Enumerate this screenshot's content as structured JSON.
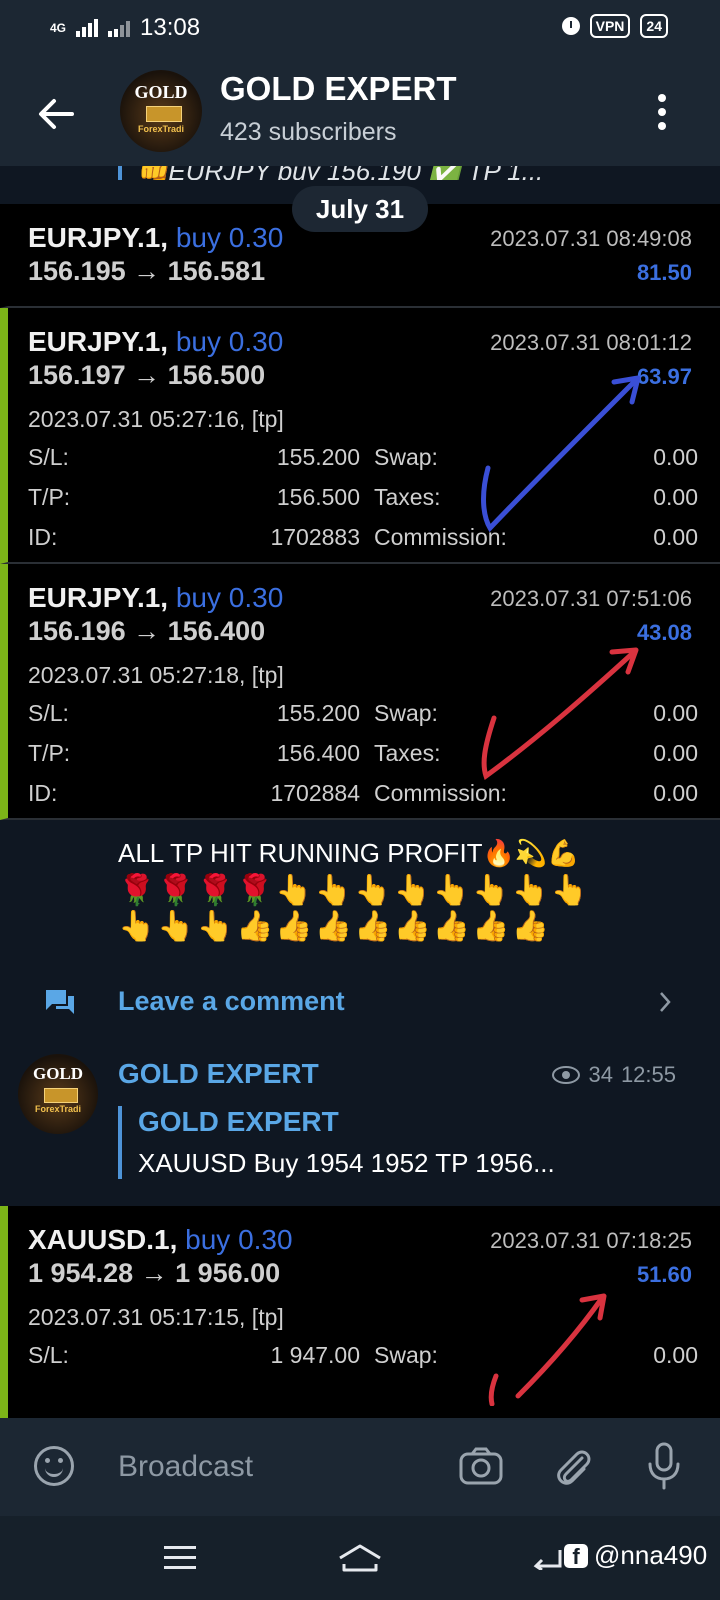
{
  "status_bar": {
    "network": "4G",
    "time": "13:08",
    "vpn": "VPN",
    "battery": "24"
  },
  "header": {
    "title": "GOLD EXPERT",
    "subtitle": "423 subscribers",
    "avatar_text": "GOLD",
    "avatar_sub": "ForexTradi"
  },
  "chat": {
    "reply_preview": "👊EURJPY buy 156.190 ✅ TP 1...",
    "date_pill": "July 31",
    "trades": [
      {
        "symbol": "EURJPY.1,",
        "dir": "buy 0.30",
        "prices": "156.195 → 156.581",
        "time": "2023.07.31 08:49:08",
        "profit": "81.50"
      },
      {
        "symbol": "EURJPY.1,",
        "dir": "buy 0.30",
        "prices": "156.197 → 156.500",
        "time": "2023.07.31 08:01:12",
        "profit": "63.97",
        "open": "2023.07.31 05:27:16, [tp]",
        "sl": "155.200",
        "tp": "156.500",
        "id": "1702883",
        "swap": "0.00",
        "taxes": "0.00",
        "commission": "0.00"
      },
      {
        "symbol": "EURJPY.1,",
        "dir": "buy 0.30",
        "prices": "156.196 → 156.400",
        "time": "2023.07.31 07:51:06",
        "profit": "43.08",
        "open": "2023.07.31 05:27:18, [tp]",
        "sl": "155.200",
        "tp": "156.400",
        "id": "1702884",
        "swap": "0.00",
        "taxes": "0.00",
        "commission": "0.00"
      }
    ],
    "labels": {
      "sl": "S/L:",
      "tp": "T/P:",
      "id": "ID:",
      "swap": "Swap:",
      "taxes": "Taxes:",
      "commission": "Commission:"
    },
    "message_text": "ALL TP HIT  RUNNING PROFIT🔥💫💪",
    "emoji_line1": "🌹🌹🌹🌹👆👆👆👆👆👆👆👆",
    "emoji_line2": "👆👆👆👍👍👍👍👍👍👍👍",
    "comment_label": "Leave a comment",
    "post": {
      "name": "GOLD EXPERT",
      "views": "34",
      "time": "12:55",
      "reply_name": "GOLD EXPERT",
      "reply_text": "XAUUSD Buy  1954 1952 TP 1956..."
    },
    "trade4": {
      "symbol": "XAUUSD.1,",
      "dir": "buy 0.30",
      "prices": "1 954.28 → 1 956.00",
      "time": "2023.07.31 07:18:25",
      "profit": "51.60",
      "open": "2023.07.31 05:17:15, [tp]",
      "sl": "1 947.00",
      "swap": "0.00"
    }
  },
  "input": {
    "placeholder": "Broadcast"
  },
  "navbar": {
    "watermark": "@nna490",
    "fb": "f"
  },
  "colors": {
    "accent": "#5aa7e6",
    "trade_blue": "#3b6fe0",
    "trade_border": "#7cb518",
    "arrow_blue": "#3a4fd6",
    "arrow_red": "#d9333f"
  }
}
